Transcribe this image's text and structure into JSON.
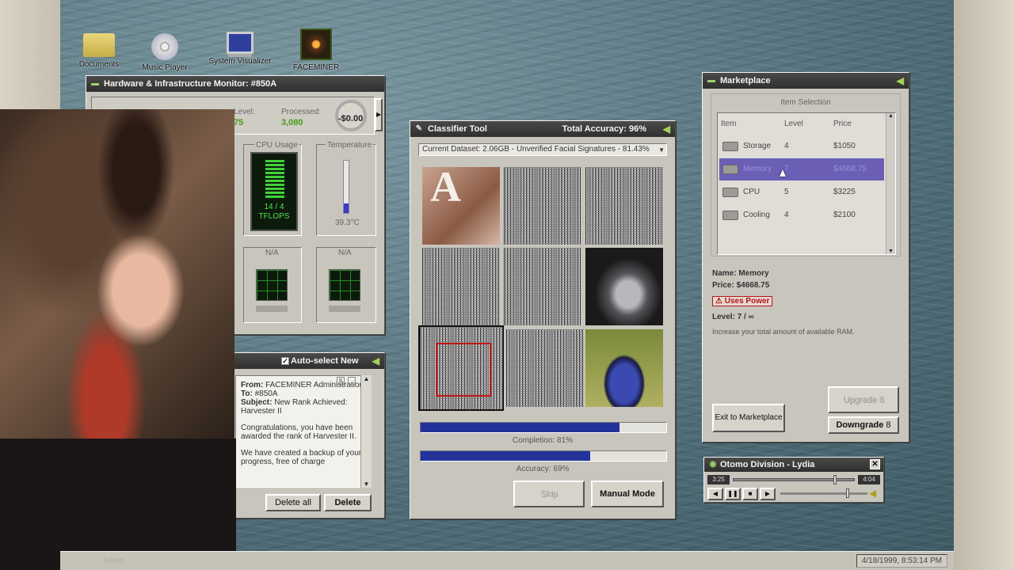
{
  "desktop": {
    "icons": [
      {
        "label": "Documents",
        "icon": "folder-icon"
      },
      {
        "label": "Music Player",
        "icon": "cd-icon"
      },
      {
        "label": "System Visualizer",
        "icon": "monitor-icon"
      },
      {
        "label": "FACEMINER",
        "icon": "faceminer-icon"
      }
    ]
  },
  "hardware": {
    "title": "Hardware & Infrastructure Monitor: #850A",
    "level_label": "Level:",
    "level_value": "75",
    "processed_label": "Processed:",
    "processed_value": "3,080",
    "balance": "-$0.00",
    "cpu_label": "CPU Usage",
    "cpu_readout_1": "14 / 4",
    "cpu_readout_2": "TFLOPS",
    "temp_label": "Temperature",
    "temp_value": "39.3°C",
    "temp_level": 0.18,
    "slot3_label": "N/A",
    "slot4_label": "N/A"
  },
  "mail": {
    "title": "Auto-select New",
    "from_label": "From:",
    "from_value": "FACEMINER Administration",
    "to_label": "To:",
    "to_value": "#850A",
    "subject_label": "Subject:",
    "subject_value": "New Rank Achieved: Harvester II",
    "body_1": "Congratulations, you have been awarded the rank of Harvester II.",
    "body_2": "We have created a backup of your progress, free of charge",
    "delete_all": "Delete all",
    "delete": "Delete"
  },
  "classifier": {
    "title": "Classifier Tool",
    "accuracy_title": "Total Accuracy: 96%",
    "dataset": "Current Dataset: 2.06GB - Unverified Facial Signatures - 81.43%",
    "letter": "A",
    "completion_label": "Completion: 81%",
    "completion_value": 0.81,
    "accuracy_label": "Accuracy: 69%",
    "accuracy_value": 0.69,
    "skip": "Skip",
    "manual": "Manual Mode"
  },
  "market": {
    "title": "Marketplace",
    "section": "Item Selection",
    "columns": [
      "Item",
      "Level",
      "Price"
    ],
    "rows": [
      {
        "item": "Storage",
        "level": "4",
        "price": "$1050",
        "icon": "storage-icon"
      },
      {
        "item": "Memory",
        "level": "7",
        "price": "$4668.75",
        "icon": "memory-icon"
      },
      {
        "item": "CPU",
        "level": "5",
        "price": "$3225",
        "icon": "cpu-icon"
      },
      {
        "item": "Cooling",
        "level": "4",
        "price": "$2100",
        "icon": "cooling-icon"
      }
    ],
    "detail_name": "Name: Memory",
    "detail_price": "Price: $4668.75",
    "badge": "⚠ Uses Power",
    "detail_level": "Level: 7 / ∞",
    "description": "Increase your total amount of available RAM.",
    "exit": "Exit to Marketplace",
    "upgrade": "Upgrade",
    "upgrade_count": "8",
    "downgrade": "Downgrade",
    "downgrade_count": "8"
  },
  "player": {
    "title": "Otomo Division - Lydia",
    "elapsed": "3:25",
    "total": "4:04",
    "progress": 0.84,
    "volume": 0.78
  },
  "taskbar": {
    "clock": "4/18/1999, 8:53:14 PM",
    "ghost": "Notes"
  },
  "colors": {
    "accent": "#2b3aa0",
    "selected_row": "#6a5fb5",
    "titlebar": "#353534",
    "green": "#4a9a1c",
    "warning": "#b5161a"
  }
}
